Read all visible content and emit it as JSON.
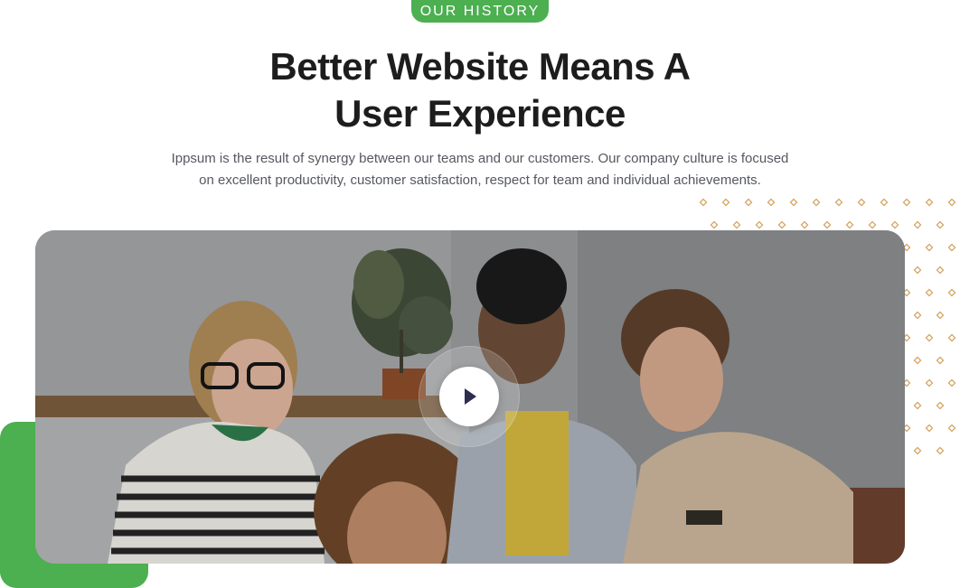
{
  "section": {
    "badge": "OUR HISTORY",
    "title_line1": "Better Website Means A",
    "title_line2": "User Experience",
    "desc_line1": "Ippsum is the result of synergy between our teams and our customers. Our company culture is focused",
    "desc_line2": "on excellent productivity, customer satisfaction, respect for team and individual achievements."
  },
  "media": {
    "play_icon": "play-icon"
  },
  "colors": {
    "accent": "#4caf50",
    "heading": "#1d1d1d",
    "body": "#555861",
    "dots": "#d4a15c",
    "play_icon": "#2c2d4f"
  }
}
